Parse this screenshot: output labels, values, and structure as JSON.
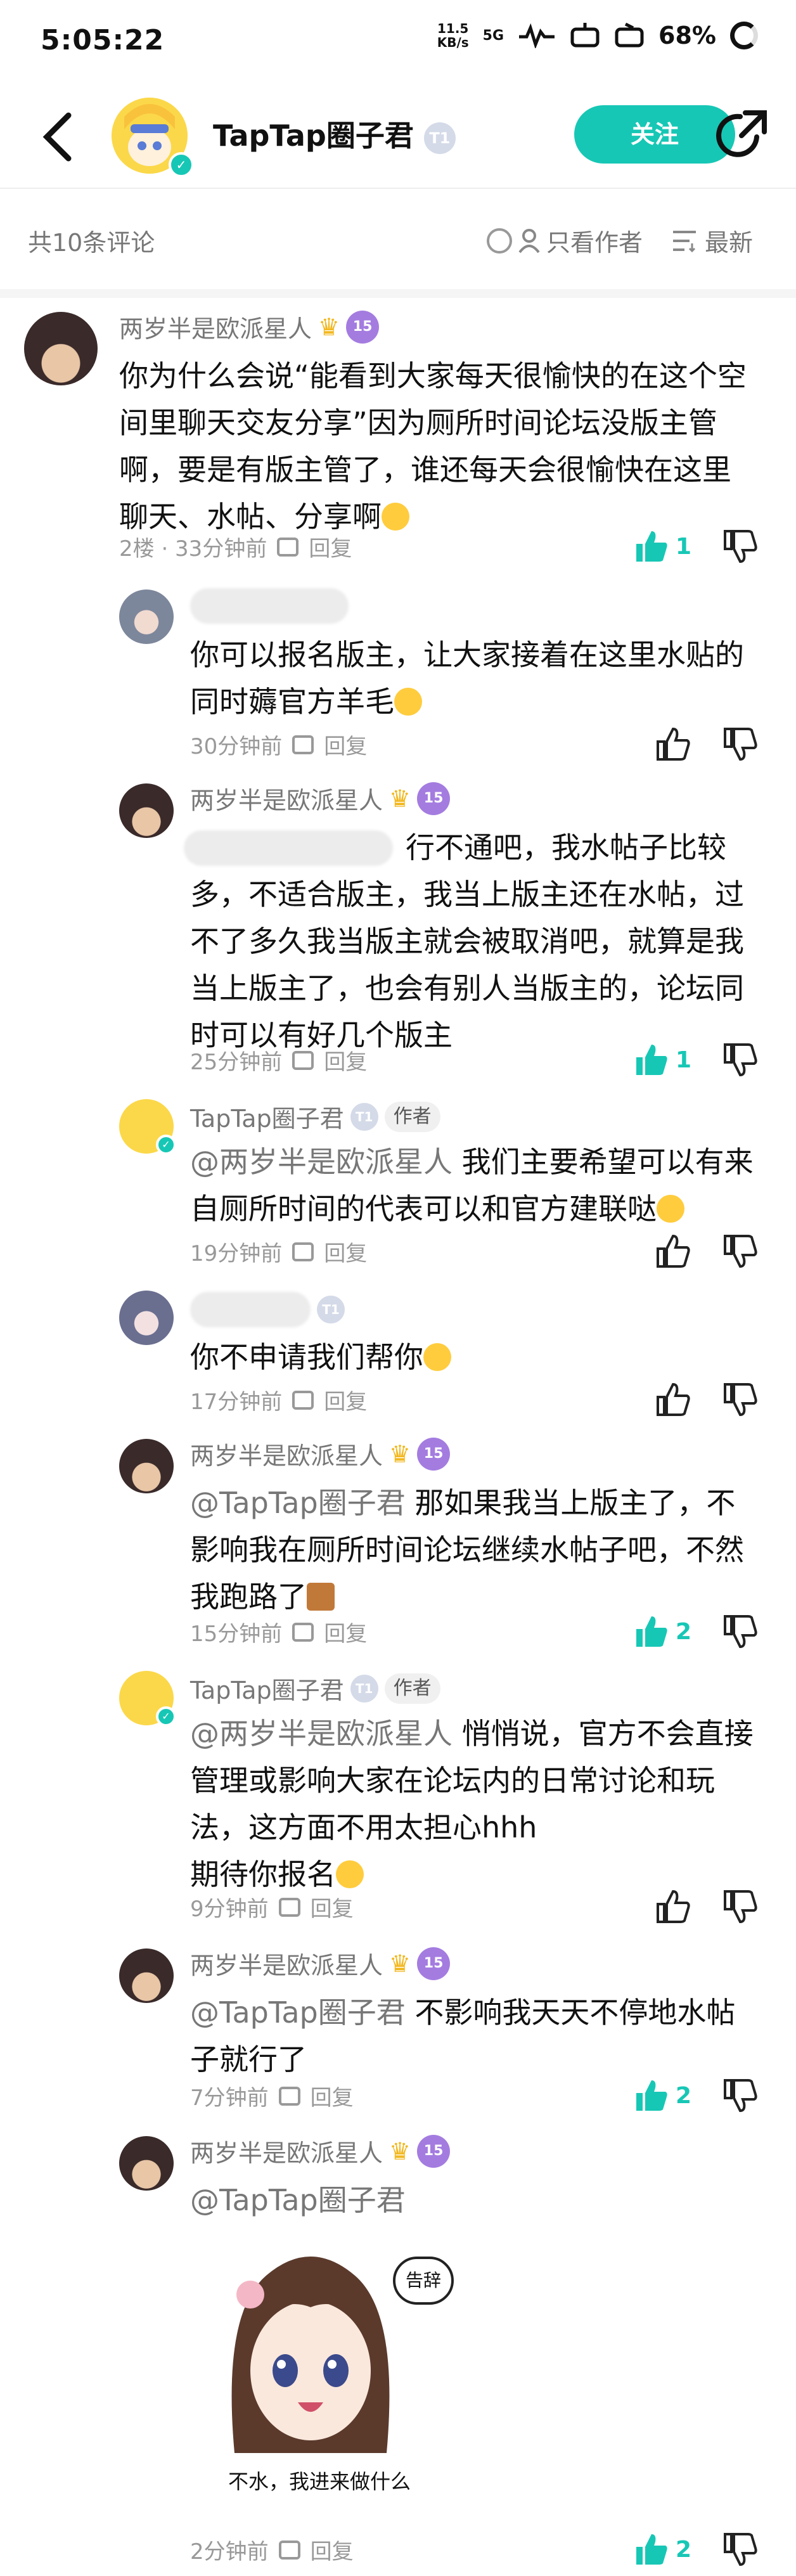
{
  "status": {
    "time": "5:05:22",
    "net_speed": "11.5\nKB/s",
    "net_type": "5G",
    "battery": "68%"
  },
  "header": {
    "title": "TapTap圈子君",
    "level_badge": "T1",
    "follow_label": "关注"
  },
  "sortbar": {
    "count": "共10条评论",
    "author_only": "只看作者",
    "sort": "最新"
  },
  "reply_label": "回复",
  "author_tag": "作者",
  "comments": [
    {
      "name": "两岁半是欧派星人",
      "badge": "15",
      "text": "你为什么会说“能看到大家每天很愉快的在这个空间里聊天交友分享”因为厕所时间论坛没版主管啊，要是有版主管了，谁还每天会很愉快在这里聊天、水帖、分享啊",
      "time": "2楼 · 33分钟前",
      "likes": "1"
    },
    {
      "text": "你可以报名版主，让大家接着在这里水贴的同时薅官方羊毛",
      "time": "30分钟前"
    },
    {
      "name": "两岁半是欧派星人",
      "badge": "15",
      "text": "行不通吧，我水帖子比较多，不适合版主，我当上版主还在水帖，过不了多久我当版主就会被取消吧，就算是我当上版主了，也会有别人当版主的，论坛同时可以有好几个版主",
      "time": "25分钟前",
      "likes": "1"
    },
    {
      "name": "TapTap圈子君",
      "level": "T1",
      "mention": "@两岁半是欧派星人",
      "text": " 我们主要希望可以有来自厕所时间的代表可以和官方建联哒",
      "time": "19分钟前"
    },
    {
      "level": "T1",
      "text": "你不申请我们帮你",
      "time": "17分钟前"
    },
    {
      "name": "两岁半是欧派星人",
      "badge": "15",
      "mention": "@TapTap圈子君",
      "text": " 那如果我当上版主了，不影响我在厕所时间论坛继续水帖子吧，不然我跑路了",
      "time": "15分钟前",
      "likes": "2"
    },
    {
      "name": "TapTap圈子君",
      "level": "T1",
      "mention": "@两岁半是欧派星人",
      "text": " 悄悄说，官方不会直接管理或影响大家在论坛内的日常讨论和玩法，这方面不用太担心hhh",
      "text2": "期待你报名",
      "time": "9分钟前"
    },
    {
      "name": "两岁半是欧派星人",
      "badge": "15",
      "mention": "@TapTap圈子君",
      "text": " 不影响我天天不停地水帖子就行了",
      "time": "7分钟前",
      "likes": "2"
    },
    {
      "name": "两岁半是欧派星人",
      "badge": "15",
      "mention": "@TapTap圈子君",
      "sticker_bubble": "告辞",
      "sticker_caption": "不水，我进来做什么",
      "time": "2分钟前",
      "likes": "2"
    }
  ],
  "colors": {
    "accent": "#17c7b5",
    "muted": "#999999",
    "badge_purple": "#a47ce0",
    "crown": "#f2b820"
  }
}
